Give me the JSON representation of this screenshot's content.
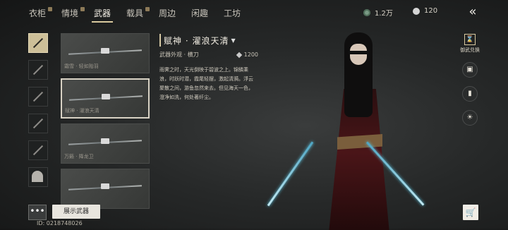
{
  "nav": {
    "tabs": [
      {
        "label": "衣柜",
        "badge": true
      },
      {
        "label": "情境",
        "badge": true
      },
      {
        "label": "武器",
        "badge": false,
        "active": true
      },
      {
        "label": "载具",
        "badge": true
      },
      {
        "label": "周边",
        "badge": false
      },
      {
        "label": "闲趣",
        "badge": false
      },
      {
        "label": "工坊",
        "badge": false
      }
    ]
  },
  "currency": {
    "jade": "1.2万",
    "silver": "120"
  },
  "cards": [
    {
      "name": "霜雪 · 轻如贻羽"
    },
    {
      "name": "赋神 · 濯浪天清"
    },
    {
      "name": "万籁 · 降龙卫"
    },
    {
      "name": ""
    }
  ],
  "detail": {
    "title": "赋神 · 濯浪天清",
    "category": "武器外观 · 横刀",
    "price": "1200",
    "description": "雨霁之时，天光倒映于碧波之上。锦鳞乘浪，时跃时潜，霞尾轻摆，激起清漪。浮云聚散之间，游鱼忽然来去。但见海天一色，澄净如洗，何处著纤尘。"
  },
  "side": {
    "exchange_label": "御武兑换"
  },
  "bottom": {
    "more_label": "•••",
    "show_label": "展示武器",
    "player_id": "ID: 0218748026"
  },
  "colors": {
    "accent": "#d8c9a0",
    "background": "#262828",
    "selected_border": "#d8d2c4"
  }
}
